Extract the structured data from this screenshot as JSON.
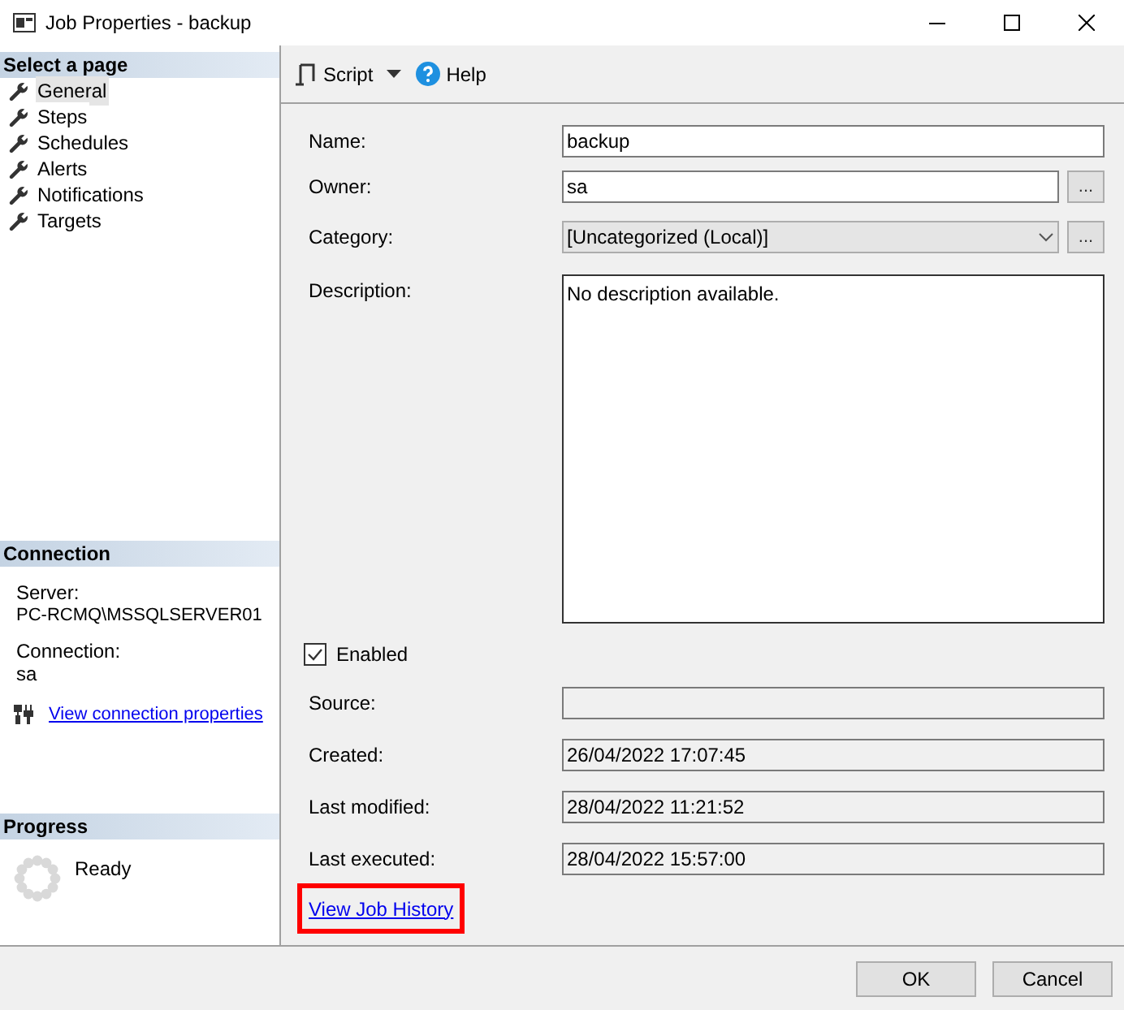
{
  "window": {
    "title": "Job Properties - backup"
  },
  "select_page": {
    "title": "Select a page",
    "items": [
      {
        "label": "General",
        "selected": true
      },
      {
        "label": "Steps",
        "selected": false
      },
      {
        "label": "Schedules",
        "selected": false
      },
      {
        "label": "Alerts",
        "selected": false
      },
      {
        "label": "Notifications",
        "selected": false
      },
      {
        "label": "Targets",
        "selected": false
      }
    ]
  },
  "connection": {
    "title": "Connection",
    "server_label": "Server:",
    "server": "PC-RCMQ\\MSSQLSERVER01",
    "connection_label": "Connection:",
    "connection": "sa",
    "link": "View connection properties"
  },
  "progress": {
    "title": "Progress",
    "status": "Ready"
  },
  "toolbar": {
    "script": "Script",
    "help": "Help"
  },
  "fields": [
    {
      "kind": "text",
      "label": "Name:",
      "value": "backup"
    },
    {
      "kind": "text",
      "label": "Owner:",
      "value": "sa",
      "button": "..."
    },
    {
      "kind": "combo",
      "label": "Category:",
      "value": "[Uncategorized (Local)]",
      "button": "..."
    },
    {
      "kind": "memo",
      "label": "Description:",
      "value": "No description available."
    }
  ],
  "enabled": {
    "label": "Enabled",
    "checked": true
  },
  "info_fields": [
    {
      "label": "Source:"
    },
    {
      "label": "Created:",
      "value": "26/04/2022 17:07:45"
    },
    {
      "label": "Last modified:",
      "value": "28/04/2022 11:21:52"
    },
    {
      "label": "Last executed:",
      "value": "28/04/2022 15:57:00"
    }
  ],
  "history_link": {
    "label": "View Job History",
    "highlighted": true
  },
  "buttons": [
    "OK",
    "Cancel"
  ]
}
